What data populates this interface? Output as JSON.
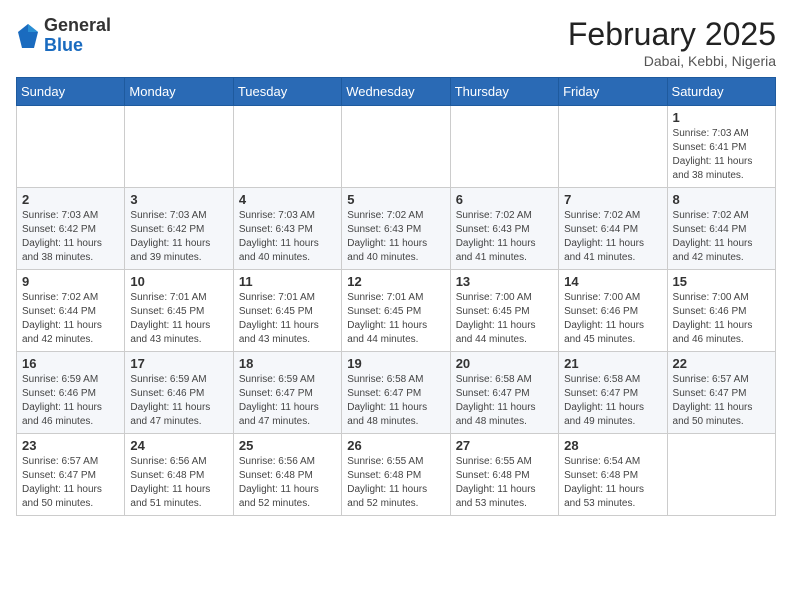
{
  "header": {
    "logo": {
      "general": "General",
      "blue": "Blue"
    },
    "title": "February 2025",
    "subtitle": "Dabai, Kebbi, Nigeria"
  },
  "calendar": {
    "days_of_week": [
      "Sunday",
      "Monday",
      "Tuesday",
      "Wednesday",
      "Thursday",
      "Friday",
      "Saturday"
    ],
    "weeks": [
      [
        {
          "day": "",
          "info": ""
        },
        {
          "day": "",
          "info": ""
        },
        {
          "day": "",
          "info": ""
        },
        {
          "day": "",
          "info": ""
        },
        {
          "day": "",
          "info": ""
        },
        {
          "day": "",
          "info": ""
        },
        {
          "day": "1",
          "info": "Sunrise: 7:03 AM\nSunset: 6:41 PM\nDaylight: 11 hours and 38 minutes."
        }
      ],
      [
        {
          "day": "2",
          "info": "Sunrise: 7:03 AM\nSunset: 6:42 PM\nDaylight: 11 hours and 38 minutes."
        },
        {
          "day": "3",
          "info": "Sunrise: 7:03 AM\nSunset: 6:42 PM\nDaylight: 11 hours and 39 minutes."
        },
        {
          "day": "4",
          "info": "Sunrise: 7:03 AM\nSunset: 6:43 PM\nDaylight: 11 hours and 40 minutes."
        },
        {
          "day": "5",
          "info": "Sunrise: 7:02 AM\nSunset: 6:43 PM\nDaylight: 11 hours and 40 minutes."
        },
        {
          "day": "6",
          "info": "Sunrise: 7:02 AM\nSunset: 6:43 PM\nDaylight: 11 hours and 41 minutes."
        },
        {
          "day": "7",
          "info": "Sunrise: 7:02 AM\nSunset: 6:44 PM\nDaylight: 11 hours and 41 minutes."
        },
        {
          "day": "8",
          "info": "Sunrise: 7:02 AM\nSunset: 6:44 PM\nDaylight: 11 hours and 42 minutes."
        }
      ],
      [
        {
          "day": "9",
          "info": "Sunrise: 7:02 AM\nSunset: 6:44 PM\nDaylight: 11 hours and 42 minutes."
        },
        {
          "day": "10",
          "info": "Sunrise: 7:01 AM\nSunset: 6:45 PM\nDaylight: 11 hours and 43 minutes."
        },
        {
          "day": "11",
          "info": "Sunrise: 7:01 AM\nSunset: 6:45 PM\nDaylight: 11 hours and 43 minutes."
        },
        {
          "day": "12",
          "info": "Sunrise: 7:01 AM\nSunset: 6:45 PM\nDaylight: 11 hours and 44 minutes."
        },
        {
          "day": "13",
          "info": "Sunrise: 7:00 AM\nSunset: 6:45 PM\nDaylight: 11 hours and 44 minutes."
        },
        {
          "day": "14",
          "info": "Sunrise: 7:00 AM\nSunset: 6:46 PM\nDaylight: 11 hours and 45 minutes."
        },
        {
          "day": "15",
          "info": "Sunrise: 7:00 AM\nSunset: 6:46 PM\nDaylight: 11 hours and 46 minutes."
        }
      ],
      [
        {
          "day": "16",
          "info": "Sunrise: 6:59 AM\nSunset: 6:46 PM\nDaylight: 11 hours and 46 minutes."
        },
        {
          "day": "17",
          "info": "Sunrise: 6:59 AM\nSunset: 6:46 PM\nDaylight: 11 hours and 47 minutes."
        },
        {
          "day": "18",
          "info": "Sunrise: 6:59 AM\nSunset: 6:47 PM\nDaylight: 11 hours and 47 minutes."
        },
        {
          "day": "19",
          "info": "Sunrise: 6:58 AM\nSunset: 6:47 PM\nDaylight: 11 hours and 48 minutes."
        },
        {
          "day": "20",
          "info": "Sunrise: 6:58 AM\nSunset: 6:47 PM\nDaylight: 11 hours and 48 minutes."
        },
        {
          "day": "21",
          "info": "Sunrise: 6:58 AM\nSunset: 6:47 PM\nDaylight: 11 hours and 49 minutes."
        },
        {
          "day": "22",
          "info": "Sunrise: 6:57 AM\nSunset: 6:47 PM\nDaylight: 11 hours and 50 minutes."
        }
      ],
      [
        {
          "day": "23",
          "info": "Sunrise: 6:57 AM\nSunset: 6:47 PM\nDaylight: 11 hours and 50 minutes."
        },
        {
          "day": "24",
          "info": "Sunrise: 6:56 AM\nSunset: 6:48 PM\nDaylight: 11 hours and 51 minutes."
        },
        {
          "day": "25",
          "info": "Sunrise: 6:56 AM\nSunset: 6:48 PM\nDaylight: 11 hours and 52 minutes."
        },
        {
          "day": "26",
          "info": "Sunrise: 6:55 AM\nSunset: 6:48 PM\nDaylight: 11 hours and 52 minutes."
        },
        {
          "day": "27",
          "info": "Sunrise: 6:55 AM\nSunset: 6:48 PM\nDaylight: 11 hours and 53 minutes."
        },
        {
          "day": "28",
          "info": "Sunrise: 6:54 AM\nSunset: 6:48 PM\nDaylight: 11 hours and 53 minutes."
        },
        {
          "day": "",
          "info": ""
        }
      ]
    ]
  }
}
